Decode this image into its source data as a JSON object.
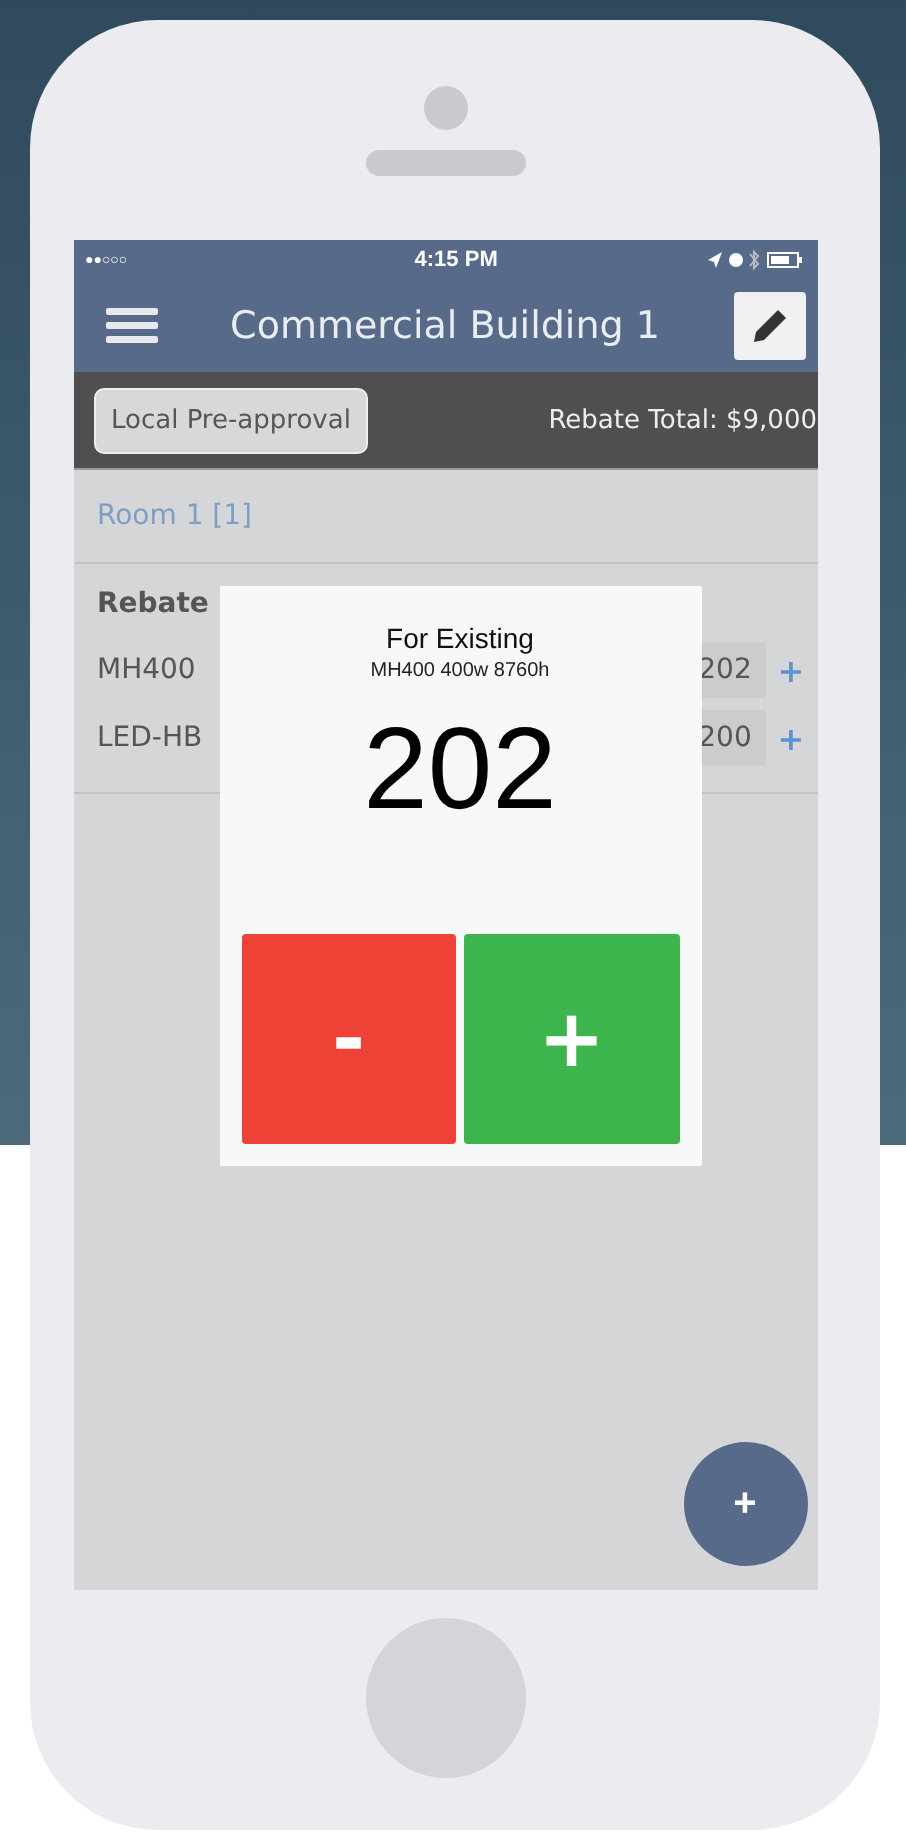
{
  "status_bar": {
    "carrier_dots": "●●○○○",
    "time": "4:15 PM"
  },
  "header": {
    "title": "Commercial Building 1"
  },
  "subbar": {
    "button": "Local Pre-approval",
    "rebate_total": "Rebate Total: $9,000"
  },
  "room": {
    "title": "Room 1 [1]"
  },
  "rebate": {
    "label": "Rebate"
  },
  "rows": [
    {
      "name": "MH400",
      "quantity": "202",
      "plus": "+"
    },
    {
      "name": "LED-HB",
      "quantity": "200",
      "plus": "+"
    }
  ],
  "modal": {
    "title": "For Existing",
    "subtitle": "MH400 400w 8760h",
    "value": "202",
    "minus": "-",
    "plus": "+"
  },
  "fab": {
    "label": "+"
  }
}
